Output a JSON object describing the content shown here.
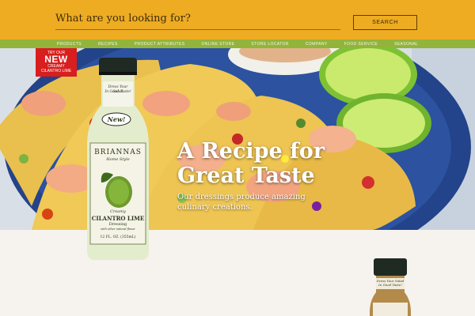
{
  "search": {
    "placeholder": "What are you looking for?",
    "button_label": "SEARCH"
  },
  "nav": {
    "items": [
      {
        "label": "PRODUCTS"
      },
      {
        "label": "RECIPES"
      },
      {
        "label": "PRODUCT ATTRIBUTES"
      },
      {
        "label": "ONLINE STORE"
      },
      {
        "label": "STORE LOCATOR"
      },
      {
        "label": "COMPANY"
      },
      {
        "label": "FOOD SERVICE"
      },
      {
        "label": "SEASONAL"
      }
    ]
  },
  "promo": {
    "line1": "TRY OUR",
    "line2": "NEW",
    "line3": "CREAMY",
    "line4": "CILANTRO LIME"
  },
  "hero": {
    "title": "A Recipe for Great Taste",
    "subtitle": "Our dressings produce amazing culinary creations."
  },
  "product": {
    "neck_tag_1": "Dress Your Salad",
    "neck_tag_2": "In Good Taste!",
    "new_tag": "New!",
    "brand": "BRIANNAS",
    "brand_sub": "Home Style",
    "variety_1": "Creamy",
    "variety_2": "CILANTRO LIME",
    "variety_3": "Dressing",
    "note": "with other natural flavor",
    "size": "12 FL. OZ. (355mL)"
  },
  "product_small": {
    "neck_tag_1": "Dress Your Salad",
    "neck_tag_2": "In Good Taste!"
  },
  "colors": {
    "search_bg": "#eeac22",
    "nav_bg": "#93b43a",
    "badge_red": "#d81e1e",
    "page_bg": "#f6f3ee"
  }
}
